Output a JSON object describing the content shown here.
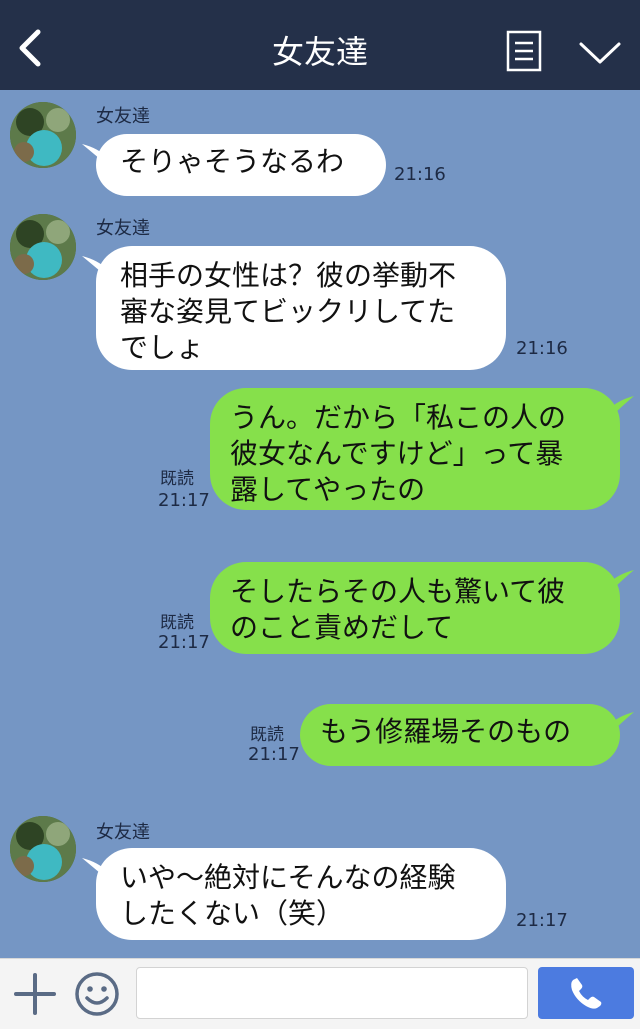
{
  "header": {
    "title": "女友達"
  },
  "messages": [
    {
      "sender": "女友達",
      "text": "そりゃそうなるわ",
      "time": "21:16"
    },
    {
      "sender": "女友達",
      "lines": [
        "相手の女性は？彼の挙動不",
        "審な姿見てビックリしてた",
        "でしょ"
      ],
      "time": "21:16"
    },
    {
      "lines": [
        "うん。だから「私この人の",
        "彼女なんですけど」って暴",
        "露してやったの"
      ],
      "read": "既読",
      "time": "21:17"
    },
    {
      "lines": [
        "そしたらその人も驚いて彼",
        "のこと責めだして"
      ],
      "read": "既読",
      "time": "21:17"
    },
    {
      "text": "もう修羅場そのもの",
      "read": "既読",
      "time": "21:17"
    },
    {
      "sender": "女友達",
      "lines": [
        "いや〜絶対にそんなの経験",
        "したくない（笑）"
      ],
      "time": "21:17"
    }
  ],
  "colors": {
    "header_bg": "#243049",
    "chat_bg": "#7596c4",
    "incoming": "#ffffff",
    "outgoing": "#86e04b",
    "send_button": "#4c7be0"
  },
  "icons": [
    "back-icon",
    "menu-icon",
    "chevron-down-icon",
    "plus-icon",
    "smile-icon",
    "phone-icon"
  ]
}
